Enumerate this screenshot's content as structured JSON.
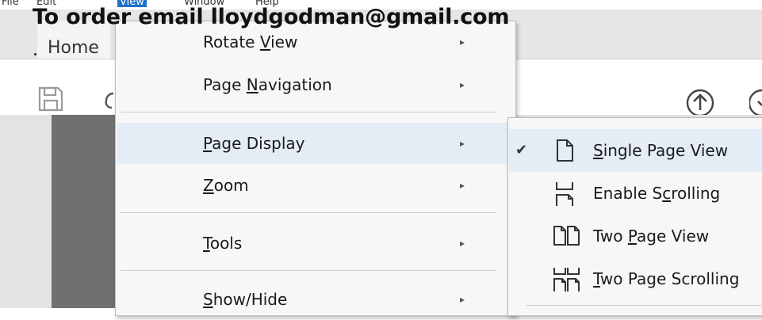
{
  "watermark": "To order email lloydgodman@gmail.com",
  "menubar": {
    "items": [
      "File",
      "Edit",
      "View",
      "Window",
      "Help"
    ],
    "active": "View"
  },
  "tabs": {
    "home": "Home"
  },
  "view_menu": {
    "items": [
      {
        "pre": "Rotate ",
        "u": "V",
        "post": "iew",
        "submenu": true
      },
      {
        "pre": "Page ",
        "u": "N",
        "post": "avigation",
        "submenu": true
      },
      {
        "pre": "",
        "u": "P",
        "post": "age Display",
        "submenu": true,
        "highlighted": true
      },
      {
        "pre": "",
        "u": "Z",
        "post": "oom",
        "submenu": true
      },
      {
        "pre": "",
        "u": "T",
        "post": "ools",
        "submenu": true
      },
      {
        "pre": "",
        "u": "S",
        "post": "how/Hide",
        "submenu": true
      }
    ]
  },
  "page_display_menu": {
    "items": [
      {
        "pre": "",
        "u": "S",
        "post": "ingle Page View",
        "checked": true,
        "icon": "single-page-icon"
      },
      {
        "pre": "Enable S",
        "u": "c",
        "post": "rolling",
        "checked": false,
        "icon": "scrolling-icon"
      },
      {
        "pre": "Two ",
        "u": "P",
        "post": "age View",
        "checked": false,
        "icon": "two-page-icon"
      },
      {
        "pre": "",
        "u": "T",
        "post": "wo Page Scrolling",
        "checked": false,
        "icon": "two-page-scrolling-icon"
      }
    ]
  },
  "glyphs": {
    "arrow": "▸",
    "check": "✔"
  }
}
